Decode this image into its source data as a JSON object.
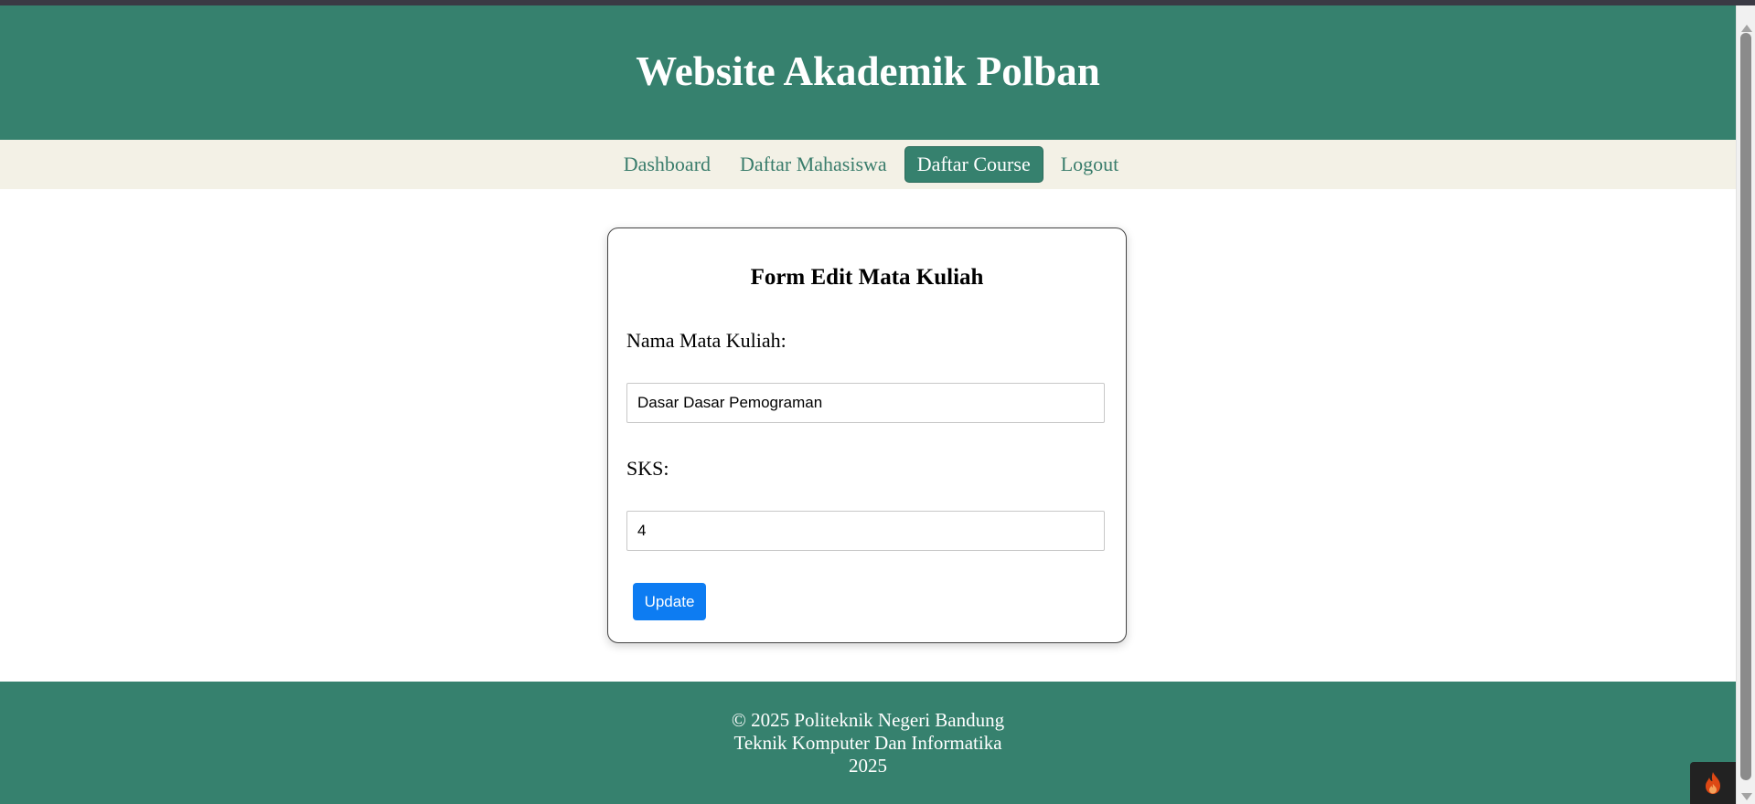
{
  "header": {
    "title": "Website Akademik Polban"
  },
  "nav": {
    "items": [
      {
        "label": "Dashboard",
        "active": false
      },
      {
        "label": "Daftar Mahasiswa",
        "active": false
      },
      {
        "label": "Daftar Course",
        "active": true
      },
      {
        "label": "Logout",
        "active": false
      }
    ]
  },
  "form": {
    "title": "Form Edit Mata Kuliah",
    "name_label": "Nama Mata Kuliah:",
    "name_value": "Dasar Dasar Pemograman",
    "sks_label": "SKS:",
    "sks_value": "4",
    "submit_label": "Update"
  },
  "footer": {
    "line1": "© 2025 Politeknik Negeri Bandung",
    "line2": "Teknik Komputer Dan Informatika",
    "line3": "2025"
  },
  "icons": {
    "debug_toolbar": "flame-icon"
  },
  "colors": {
    "brand": "#36816e",
    "nav_background": "#f3f1e6",
    "button": "#0d7cf2"
  }
}
